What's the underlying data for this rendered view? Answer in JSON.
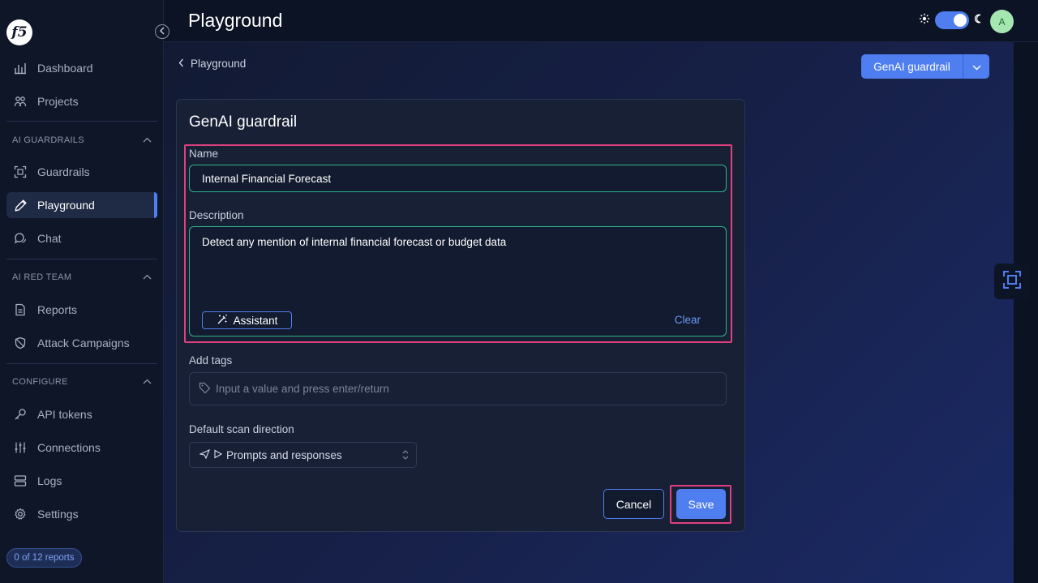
{
  "sidebar": {
    "logo_text": "f5",
    "items": [
      {
        "label": "Dashboard",
        "icon": "bar-chart-icon"
      },
      {
        "label": "Projects",
        "icon": "users-group-icon"
      }
    ],
    "sections": [
      {
        "title": "AI GUARDRAILS",
        "items": [
          {
            "label": "Guardrails",
            "icon": "scan-icon"
          },
          {
            "label": "Playground",
            "icon": "pencil-icon",
            "active": true
          },
          {
            "label": "Chat",
            "icon": "chat-icon"
          }
        ]
      },
      {
        "title": "AI RED TEAM",
        "items": [
          {
            "label": "Reports",
            "icon": "document-icon"
          },
          {
            "label": "Attack Campaigns",
            "icon": "shield-slash-icon"
          }
        ]
      },
      {
        "title": "CONFIGURE",
        "items": [
          {
            "label": "API tokens",
            "icon": "key-icon"
          },
          {
            "label": "Connections",
            "icon": "sliders-icon"
          },
          {
            "label": "Logs",
            "icon": "server-icon"
          },
          {
            "label": "Settings",
            "icon": "gear-icon"
          }
        ]
      }
    ],
    "reports_badge": "0 of 12 reports"
  },
  "header": {
    "title": "Playground",
    "avatar_initial": "A"
  },
  "breadcrumb": {
    "label": "Playground"
  },
  "guardrail_dropdown": {
    "label": "GenAI guardrail"
  },
  "form": {
    "title": "GenAI guardrail",
    "name_label": "Name",
    "name_value": "Internal Financial Forecast",
    "description_label": "Description",
    "description_value": "Detect any mention of internal financial forecast or budget data",
    "assistant_label": "Assistant",
    "clear_label": "Clear",
    "tags_label": "Add tags",
    "tags_placeholder": "Input a value and press enter/return",
    "scan_direction_label": "Default scan direction",
    "scan_direction_value": "Prompts and responses",
    "cancel_label": "Cancel",
    "save_label": "Save"
  },
  "colors": {
    "accent": "#4f7ef0",
    "highlight": "#e0407d",
    "valid_border": "#2fb48a"
  }
}
